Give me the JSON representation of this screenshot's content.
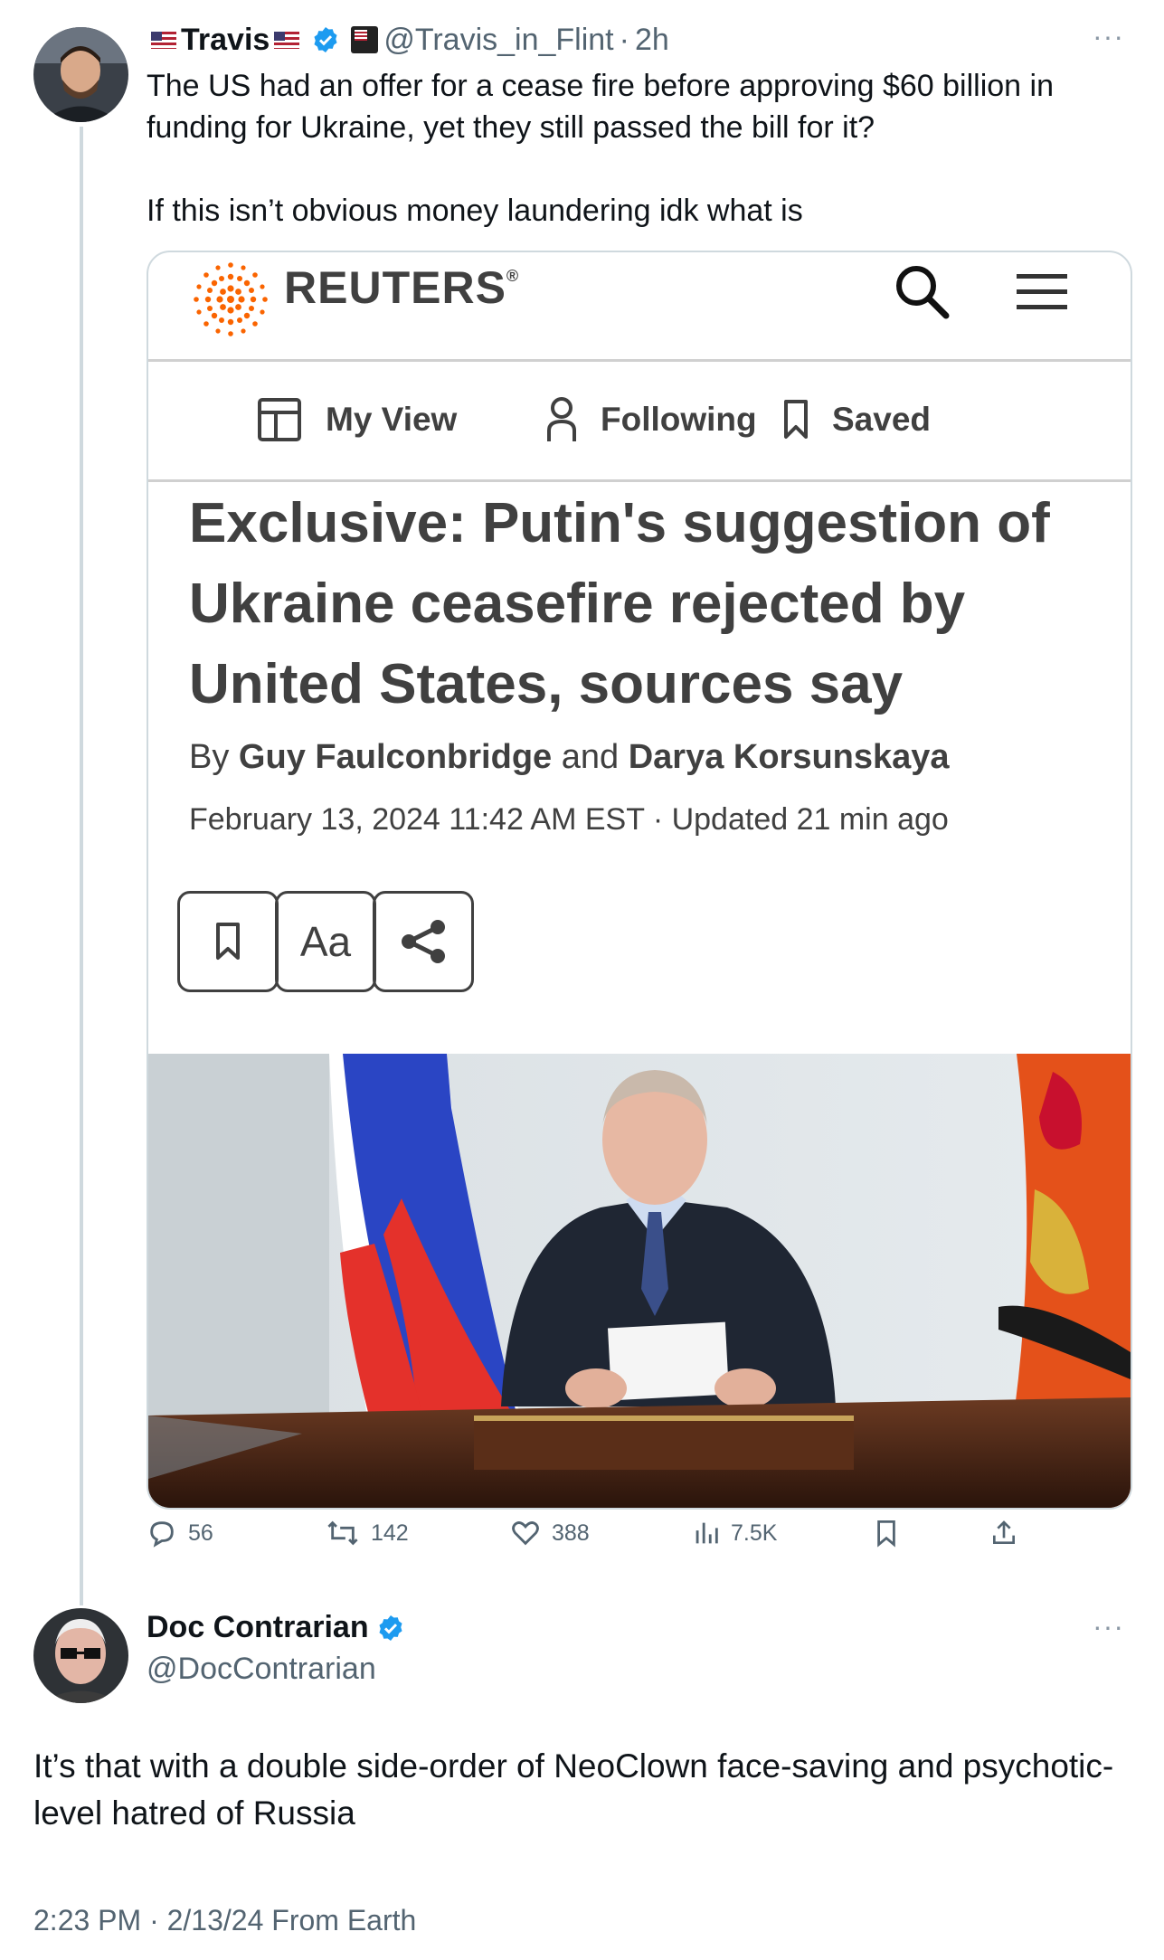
{
  "tweet1": {
    "display_name": "Travis",
    "handle": "@Travis_in_Flint",
    "time_sep": "·",
    "time": "2h",
    "more_icon": "···",
    "text_line1": "The US had an offer for a cease fire before approving $60 billion in",
    "text_line2": "funding for Ukraine, yet they still passed the bill for it?",
    "text_line3": "If this isn’t obvious money laundering idk what is",
    "stats": {
      "replies": "56",
      "retweets": "142",
      "likes": "388",
      "views": "7.5K"
    }
  },
  "article": {
    "brand": "REUTERS",
    "brand_mark": "®",
    "nav": [
      "My View",
      "Following",
      "Saved"
    ],
    "headline": "Exclusive: Putin's suggestion of Ukraine ceasefire rejected by United States, sources say",
    "byline_prefix": "By",
    "author1": "Guy Faulconbridge",
    "byline_and": "and",
    "author2": "Darya Korsunskaya",
    "dateline": "February 13, 2024 11:42 AM EST · Updated 21 min ago",
    "text_size_button": "Aa"
  },
  "tweet2": {
    "display_name": "Doc Contrarian",
    "handle": "@DocContrarian",
    "more_icon": "···",
    "text": "It’s that with a double side-order of NeoClown face-saving and psychotic-level hatred of Russia",
    "meta": "2:23 PM · 2/13/24 From Earth"
  },
  "colors": {
    "verified_blue": "#1d9bf0",
    "reuters_orange": "#fa6400",
    "secondary_text": "#536471"
  }
}
